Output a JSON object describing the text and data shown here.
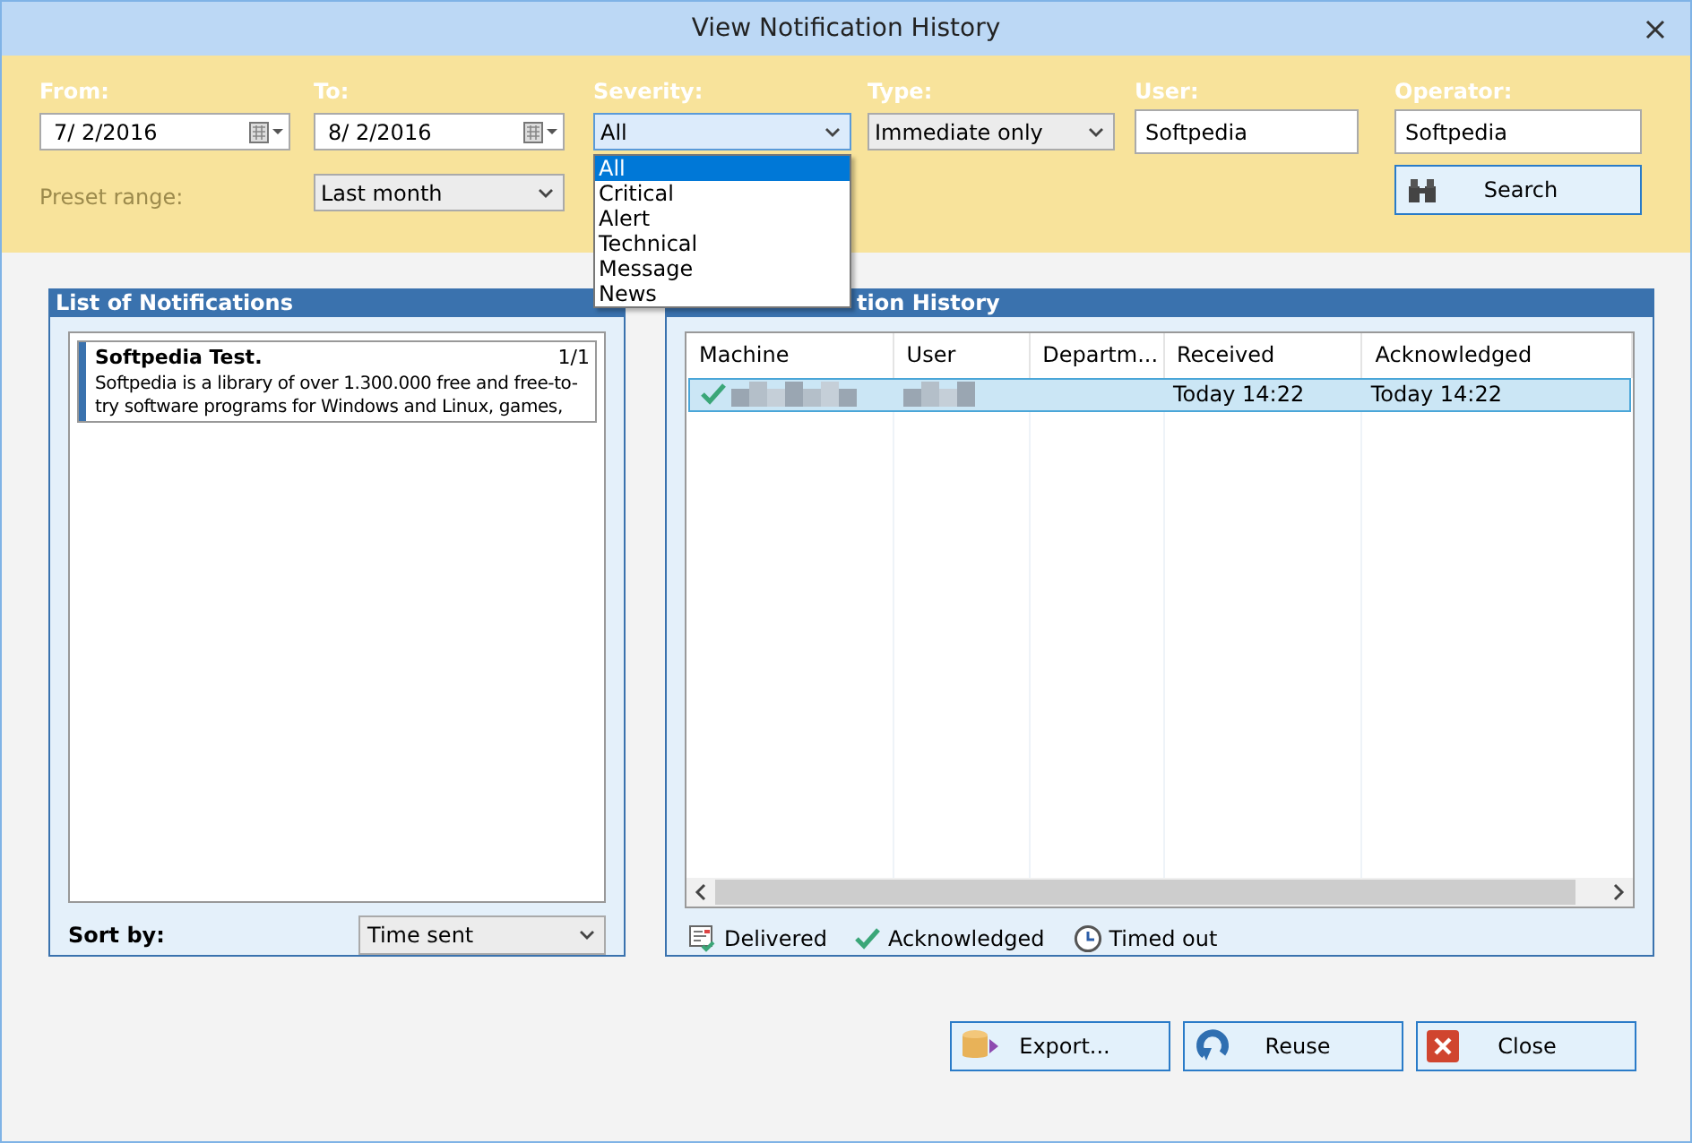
{
  "window": {
    "title": "View Notification History"
  },
  "filters": {
    "from": {
      "label": "From:",
      "value": "7/  2/2016"
    },
    "to": {
      "label": "To:",
      "value": "8/  2/2016"
    },
    "severity": {
      "label": "Severity:",
      "value": "All",
      "expanded": true,
      "options": [
        {
          "label": "All",
          "selected": true
        },
        {
          "label": "Critical",
          "selected": false
        },
        {
          "label": "Alert",
          "selected": false
        },
        {
          "label": "Technical",
          "selected": false
        },
        {
          "label": "Message",
          "selected": false
        },
        {
          "label": "News",
          "selected": false
        }
      ]
    },
    "type": {
      "label": "Type:",
      "value": "Immediate only"
    },
    "user": {
      "label": "User:",
      "value": "Softpedia"
    },
    "operator": {
      "label": "Operator:",
      "value": "Softpedia"
    },
    "preset_range": {
      "label": "Preset range:",
      "value": "Last month",
      "disabled": true
    },
    "search_button": "Search"
  },
  "notifications_panel": {
    "title": "List of Notifications",
    "items": [
      {
        "title": "Softpedia Test.",
        "count": "1/1",
        "body": "Softpedia is a library of over 1.300.000 free and free-to-try software programs for Windows and Linux, games,",
        "selected": true
      }
    ],
    "sort_label": "Sort by:",
    "sort_value": "Time sent"
  },
  "history_panel": {
    "title": "tion History",
    "columns": [
      "Machine",
      "User",
      "Departm...",
      "Received",
      "Acknowledged"
    ],
    "rows": [
      {
        "kind": "acknowledged",
        "selected": true,
        "cells": [
          "",
          "",
          "",
          "Today 14:22",
          "Today 14:22"
        ]
      }
    ],
    "legend": [
      {
        "kind": "delivered",
        "label": "Delivered"
      },
      {
        "kind": "acknowledged",
        "label": "Acknowledged"
      },
      {
        "kind": "timed_out",
        "label": "Timed out"
      }
    ]
  },
  "buttons": [
    {
      "kind": "export",
      "label": "Export..."
    },
    {
      "kind": "reuse",
      "label": "Reuse"
    },
    {
      "kind": "close",
      "label": "Close"
    }
  ]
}
